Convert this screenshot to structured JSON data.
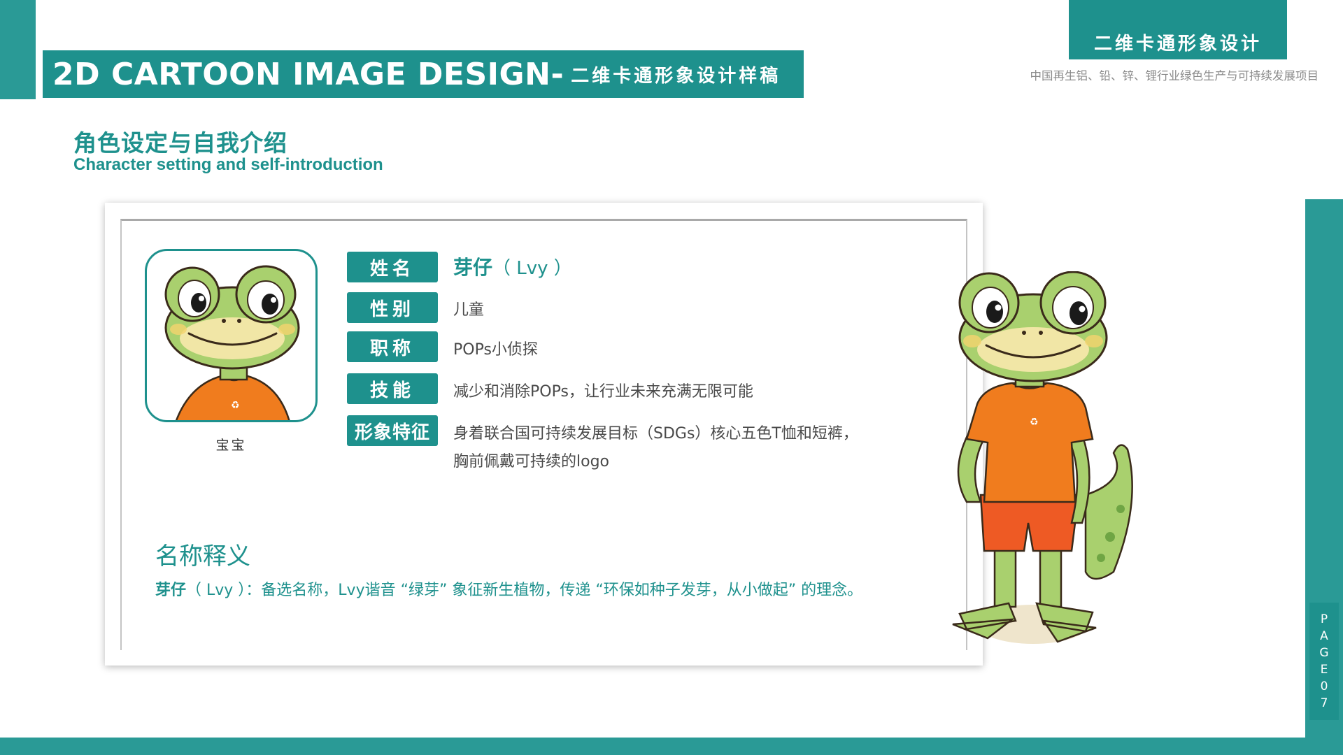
{
  "header": {
    "title_en": "2D CARTOON IMAGE DESIGN-",
    "title_cn": "二维卡通形象设计样稿",
    "badge": "二维卡通形象设计",
    "project": "中国再生铝、铅、锌、锂行业绿色生产与可持续发展项目"
  },
  "section": {
    "title_cn": "角色设定与自我介绍",
    "title_en": "Character setting and self-introduction"
  },
  "profile": {
    "avatar_caption": "宝宝",
    "rows": [
      {
        "label": "姓名",
        "value": "芽仔",
        "value_extra": "（ Lvy ）"
      },
      {
        "label": "性别",
        "value": "儿童"
      },
      {
        "label": "职称",
        "value": "POPs小侦探"
      },
      {
        "label": "技能",
        "value": "减少和消除POPs，让行业未来充满无限可能"
      },
      {
        "label": "形象特征",
        "value": "身着联合国可持续发展目标（SDGs）核心五色T恤和短裤，",
        "value_line2": "胸前佩戴可持续的logo"
      }
    ]
  },
  "naming": {
    "title": "名称释义",
    "name_bold": "芽仔",
    "text": "（ Lvy ）：备选名称，Lvy谐音 “绿芽” 象征新生植物，传递 “环保如种子发芽，从小做起” 的理念。"
  },
  "page": {
    "letters": [
      "P",
      "A",
      "G",
      "E",
      "0",
      "7"
    ]
  },
  "colors": {
    "teal": "#1e918d",
    "teal_light": "#2a9a96",
    "frog_green": "#a9d06e",
    "shirt_orange": "#f07c1e",
    "shorts_red": "#ee5a24"
  }
}
